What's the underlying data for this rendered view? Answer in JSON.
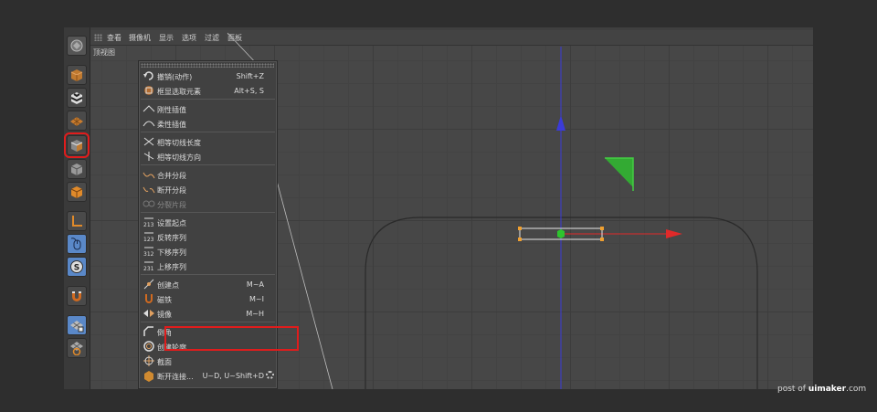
{
  "menubar": {
    "items": [
      "查看",
      "摄像机",
      "显示",
      "选项",
      "过滤",
      "面板"
    ]
  },
  "view_label": "顶视图",
  "context_menu": {
    "groups": [
      [
        {
          "label": "撤销(动作)",
          "shortcut": "Shift+Z",
          "icon": "undo-icon"
        },
        {
          "label": "框显选取元素",
          "shortcut": "Alt+S, S",
          "icon": "frame-selection-icon"
        }
      ],
      [
        {
          "label": "刚性插值",
          "shortcut": "",
          "icon": "hard-interpolation-icon"
        },
        {
          "label": "柔性插值",
          "shortcut": "",
          "icon": "soft-interpolation-icon"
        }
      ],
      [
        {
          "label": "相等切线长度",
          "shortcut": "",
          "icon": "equal-tangent-length-icon"
        },
        {
          "label": "相等切线方向",
          "shortcut": "",
          "icon": "equal-tangent-direction-icon"
        }
      ],
      [
        {
          "label": "合并分段",
          "shortcut": "",
          "icon": "join-segment-icon"
        },
        {
          "label": "断开分段",
          "shortcut": "",
          "icon": "break-segment-icon"
        },
        {
          "label": "分裂片段",
          "shortcut": "",
          "icon": "explode-segments-icon",
          "disabled": true
        }
      ],
      [
        {
          "label": "设置起点",
          "shortcut": "",
          "icon": "set-first-point-icon"
        },
        {
          "label": "反转序列",
          "shortcut": "",
          "icon": "reverse-sequence-icon"
        },
        {
          "label": "下移序列",
          "shortcut": "",
          "icon": "move-down-sequence-icon"
        },
        {
          "label": "上移序列",
          "shortcut": "",
          "icon": "move-up-sequence-icon"
        }
      ],
      [
        {
          "label": "创建点",
          "shortcut": "M~A",
          "icon": "create-point-icon"
        },
        {
          "label": "磁铁",
          "shortcut": "M~I",
          "icon": "magnet-icon"
        },
        {
          "label": "镜像",
          "shortcut": "M~H",
          "icon": "mirror-icon"
        }
      ],
      [
        {
          "label": "倒角",
          "shortcut": "",
          "icon": "chamfer-icon",
          "highlighted": true
        },
        {
          "label": "创建轮廓",
          "shortcut": "",
          "icon": "create-outline-icon"
        },
        {
          "label": "截面",
          "shortcut": "",
          "icon": "cross-section-icon"
        },
        {
          "label": "断开连接...",
          "shortcut": "U~D, U~Shift+D",
          "icon": "disconnect-icon"
        }
      ]
    ]
  },
  "toolbar": {
    "tools": [
      "app-logo-icon",
      "cube-icon",
      "checkerboard-icon",
      "texture-grid-icon",
      "object-mode-icon",
      "point-mode-icon",
      "polygon-mode-icon",
      "edge-tool-icon",
      "mouse-tool-icon",
      "snap-tool-icon",
      "magnet-tool-icon",
      "workplane-lock-icon",
      "workplane-icon"
    ],
    "selected": "object-mode-icon"
  },
  "credit": {
    "prefix": "post of ",
    "brand": "uimaker",
    "suffix": ".com"
  },
  "colors": {
    "highlight": "#e01c1c",
    "axis_x": "#e02a2a",
    "axis_y": "#3b3bd8",
    "handle": "#2ec42e",
    "spline": "#2a2a2a",
    "point": "#f0a030"
  }
}
